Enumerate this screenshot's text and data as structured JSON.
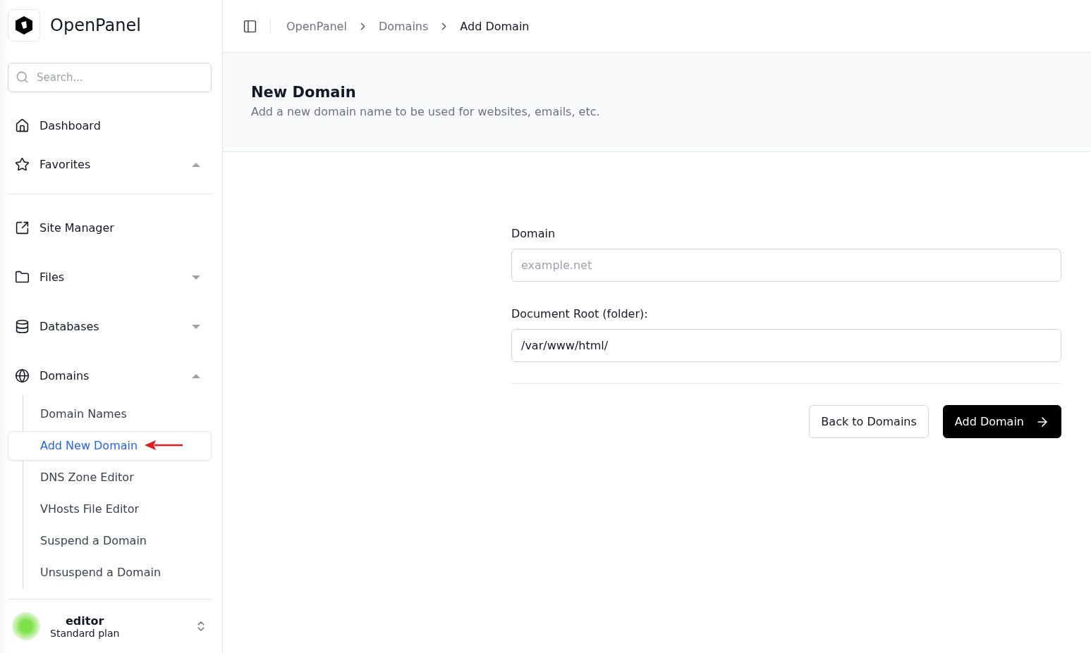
{
  "brand": {
    "name": "OpenPanel"
  },
  "search": {
    "placeholder": "Search..."
  },
  "nav": [
    {
      "kind": "home",
      "label": "Dashboard"
    },
    {
      "kind": "star",
      "label": "Favorites",
      "expanded": true
    },
    {
      "kind": "divider"
    },
    {
      "kind": "site",
      "label": "Site Manager"
    },
    {
      "kind": "folder",
      "label": "Files",
      "expanded": false
    },
    {
      "kind": "database",
      "label": "Databases",
      "expanded": false
    },
    {
      "kind": "globe",
      "label": "Domains",
      "expanded": true,
      "children": [
        {
          "label": "Domain Names",
          "selected": false
        },
        {
          "label": "Add New Domain",
          "selected": true
        },
        {
          "label": "DNS Zone Editor",
          "selected": false
        },
        {
          "label": "VHosts File Editor",
          "selected": false
        },
        {
          "label": "Suspend a Domain",
          "selected": false
        },
        {
          "label": "Unsuspend a Domain",
          "selected": false
        }
      ]
    }
  ],
  "user": {
    "name": "editor",
    "plan": "Standard plan"
  },
  "breadcrumb": [
    "OpenPanel",
    "Domains",
    "Add Domain"
  ],
  "page": {
    "title": "New Domain",
    "subtitle": "Add a new domain name to be used for websites, emails, etc."
  },
  "form": {
    "fields": [
      {
        "label": "Domain",
        "placeholder": "example.net"
      },
      {
        "label": "Document Root (folder):",
        "value": "/var/www/html/"
      }
    ],
    "buttons": [
      {
        "kind": "secondary",
        "label": "Back to Domains"
      },
      {
        "kind": "primary",
        "label": "Add Domain"
      }
    ]
  }
}
